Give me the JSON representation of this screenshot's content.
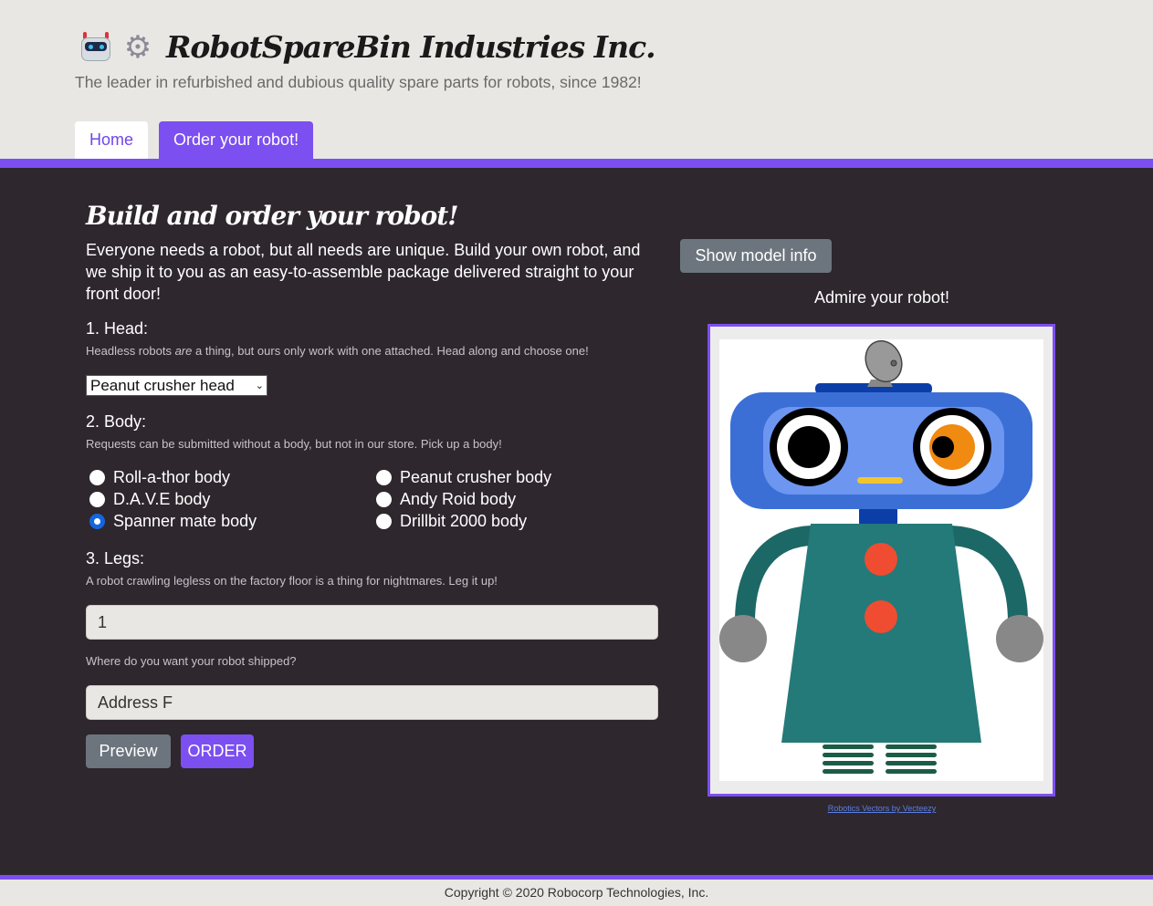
{
  "header": {
    "brand_title": "RobotSpareBin Industries Inc.",
    "tagline": "The leader in refurbished and dubious quality spare parts for robots, since 1982!",
    "logo_icons": [
      "robot-icon",
      "gear-icon"
    ]
  },
  "nav": {
    "tabs": [
      {
        "label": "Home",
        "active": false
      },
      {
        "label": "Order your robot!",
        "active": true
      }
    ]
  },
  "form": {
    "title": "Build and order your robot!",
    "intro": "Everyone needs a robot, but all needs are unique. Build your own robot, and we ship it to you as an easy-to-assemble package delivered straight to your front door!",
    "head": {
      "label": "1. Head:",
      "help_before": "Headless robots ",
      "help_em": "are",
      "help_after": " a thing, but ours only work with one attached. Head along and choose one!",
      "selected": "Peanut crusher head"
    },
    "body": {
      "label": "2. Body:",
      "help": "Requests can be submitted without a body, but not in our store. Pick up a body!",
      "options": [
        {
          "label": "Roll-a-thor body",
          "checked": false
        },
        {
          "label": "D.A.V.E body",
          "checked": false
        },
        {
          "label": "Spanner mate body",
          "checked": true
        },
        {
          "label": "Peanut crusher body",
          "checked": false
        },
        {
          "label": "Andy Roid body",
          "checked": false
        },
        {
          "label": "Drillbit 2000 body",
          "checked": false
        }
      ]
    },
    "legs": {
      "label": "3. Legs:",
      "help": "A robot crawling legless on the factory floor is a thing for nightmares. Leg it up!",
      "value": "1"
    },
    "address": {
      "help": "Where do you want your robot shipped?",
      "value": "Address F"
    },
    "buttons": {
      "preview": "Preview",
      "order": "ORDER"
    }
  },
  "preview": {
    "show_model_info": "Show model info",
    "admire": "Admire your robot!",
    "credit": "Robotics Vectors by Vecteezy"
  },
  "footer": {
    "copyright": "Copyright © 2020 Robocorp Technologies, Inc."
  },
  "colors": {
    "accent": "#7c4ff0",
    "dark_bg": "#2e272e",
    "light_bg": "#e9e7e3",
    "secondary_button": "#6c757d",
    "radio_checked": "#1466e0"
  }
}
